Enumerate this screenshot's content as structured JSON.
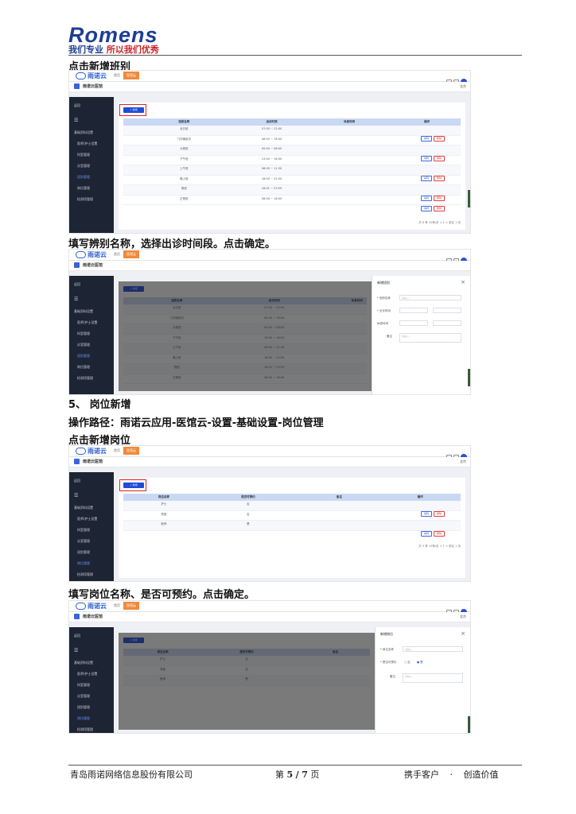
{
  "header": {
    "logo_word": "Romens",
    "slogan_a": "我们专业",
    "slogan_b": "所以我们优秀"
  },
  "captions": {
    "c1": "点击新增班别",
    "c2": "填写辨别名称，选择出诊时间段。点击确定。",
    "c3": "5、 岗位新增",
    "c4": "操作路径：雨诺云应用-医馆云-设置-基础设置-岗位管理",
    "c5": "点击新增岗位",
    "c6": "填写岗位名称、是否可预约。点击确定。"
  },
  "screenshot": {
    "brand": "雨诺云",
    "tab_home": "首页",
    "tab_active": "医馆云",
    "page_title": "雨诺云医馆",
    "right_user": "北京",
    "back": "返回",
    "menu_icon": "☰",
    "new_btn": "+ 新增",
    "sidebar": [
      "基础资料设置",
      "医师/护士设置",
      "科室管理",
      "诊室管理",
      "班别管理",
      "岗位管理",
      "检测项管理"
    ],
    "shift_headers": [
      "班别名称",
      "出诊时间",
      "休息时间",
      "操作"
    ],
    "shift_rows": [
      [
        "全日班",
        "07:00 ~ 22:00"
      ],
      [
        "门诊晚班次",
        "06:40 ~ 16:00"
      ],
      [
        "大夜班",
        "00:00 ~ 08:00"
      ],
      [
        "下午班",
        "13:00 ~ 18:00"
      ],
      [
        "上午班",
        "08:00 ~ 11:30"
      ],
      [
        "晚上班",
        "18:00 ~ 22:00"
      ],
      [
        "夜班",
        "18:01 ~ 23:59"
      ],
      [
        "正常班",
        "08:00 ~ 18:00"
      ]
    ],
    "edit": "编辑",
    "delete": "删除",
    "pager": "共 8 条   10条/页   <  1  >   前往  1  页",
    "drawer_shift_title": "新增班别",
    "drawer_shift_fields": [
      "* 班别名称",
      "* 出诊时间",
      "休息时间",
      "备注"
    ],
    "post_headers": [
      "岗位名称",
      "是否可预约",
      "备注",
      "操作"
    ],
    "post_rows": [
      [
        "护士",
        "否"
      ],
      [
        "导医",
        "否"
      ],
      [
        "医师",
        "是"
      ]
    ],
    "post_pager": "共 3 条   10条/页   <  1  >   前往  1  页",
    "drawer_post_title": "新增岗位",
    "drawer_post_fields": [
      "* 岗位名称",
      "* 是否可预约",
      "备注"
    ],
    "radio_no": "否",
    "radio_yes": "是",
    "placeholder_text": "请输入",
    "close": "×"
  },
  "footer": {
    "company": "青岛雨诺网络信息股份有限公司",
    "page_prefix": "第",
    "page_current": "5",
    "page_sep": "/",
    "page_total": "7",
    "page_suffix": "页",
    "motto_a": "携手客户",
    "motto_dot": "·",
    "motto_b": "创造价值"
  }
}
